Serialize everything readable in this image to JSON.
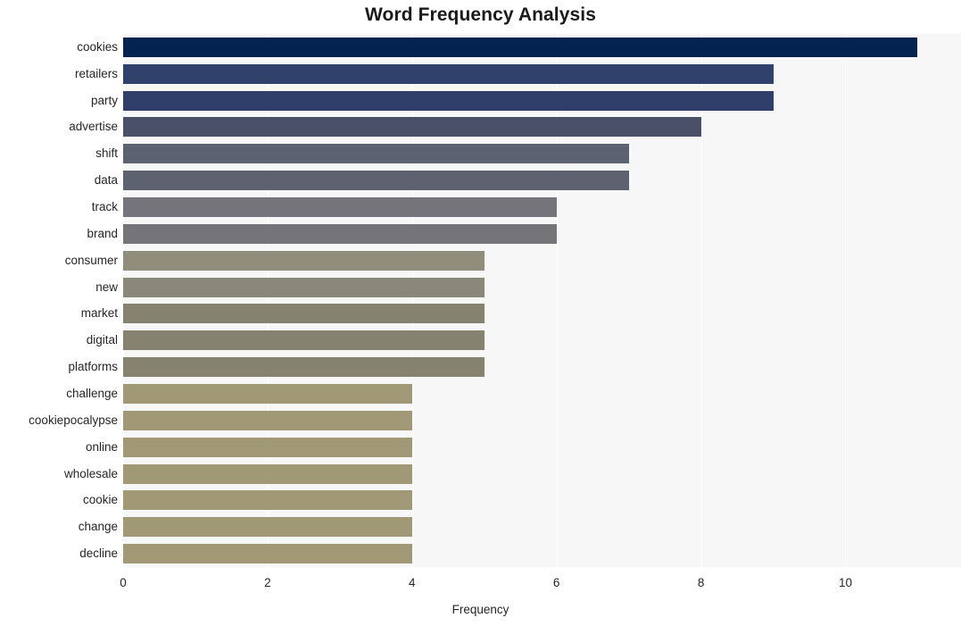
{
  "chart_data": {
    "type": "bar",
    "orientation": "horizontal",
    "title": "Word Frequency Analysis",
    "xlabel": "Frequency",
    "ylabel": "",
    "xlim": [
      0,
      11.6
    ],
    "xticks": [
      "0",
      "2",
      "4",
      "6",
      "8",
      "10"
    ],
    "xtick_values": [
      0,
      2,
      4,
      6,
      8,
      10
    ],
    "grid": "vertical",
    "legend": "none",
    "categories": [
      "cookies",
      "retailers",
      "party",
      "advertise",
      "shift",
      "data",
      "track",
      "brand",
      "consumer",
      "new",
      "market",
      "digital",
      "platforms",
      "challenge",
      "cookiepocalypse",
      "online",
      "wholesale",
      "cookie",
      "change",
      "decline"
    ],
    "values": [
      11,
      9,
      9,
      8,
      7,
      7,
      6,
      6,
      5,
      5,
      5,
      5,
      5,
      4,
      4,
      4,
      4,
      4,
      4,
      4
    ],
    "bar_colors": [
      "#04244f",
      "#30416c",
      "#2f3f6a",
      "#4a5068",
      "#5d6270",
      "#5e6270",
      "#74747a",
      "#747479",
      "#908d7c",
      "#8a8878",
      "#858370",
      "#858370",
      "#858370",
      "#a19876",
      "#a19876",
      "#a19876",
      "#a19876",
      "#a19876",
      "#a19876",
      "#a19876"
    ]
  },
  "style": {
    "plot_background": "#f7f7f7",
    "page_background": "#ffffff",
    "gridline_color": "#ffffff",
    "text_color": "#262626",
    "title_color": "#1a1a1a"
  }
}
